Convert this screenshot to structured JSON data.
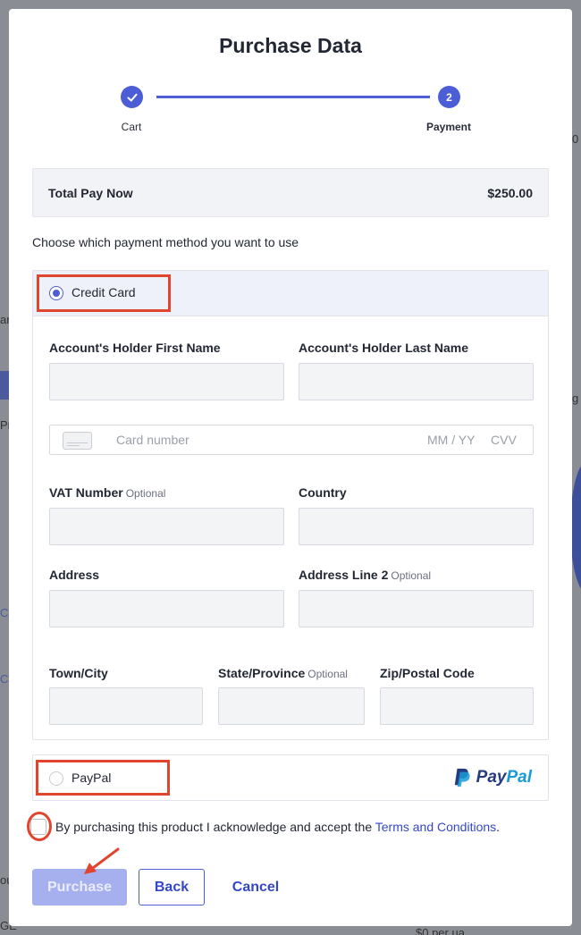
{
  "background": {
    "frag1": "0",
    "frag2": "g",
    "frag3": "an",
    "frag4": "Pr",
    "frag5": "Co",
    "frag6": "Ca",
    "frag7": "ou",
    "frag8": "GE",
    "frag9": "$0 per ua"
  },
  "modal": {
    "title": "Purchase Data",
    "steps": [
      {
        "label": "Cart",
        "state": "done",
        "icon": "check-icon"
      },
      {
        "label": "Payment",
        "number": "2",
        "state": "active"
      }
    ],
    "total": {
      "label": "Total Pay Now",
      "amount": "$250.00"
    },
    "choose_text": "Choose which payment method you want to use",
    "credit_card": {
      "label": "Credit Card",
      "selected": true,
      "first_name_label": "Account's Holder First Name",
      "last_name_label": "Account's Holder Last Name",
      "card_number_placeholder": "Card number",
      "expiry_placeholder": "MM / YY",
      "cvv_placeholder": "CVV",
      "vat_label": "VAT Number",
      "country_label": "Country",
      "address_label": "Address",
      "address2_label": "Address Line 2",
      "town_label": "Town/City",
      "state_label": "State/Province",
      "zip_label": "Zip/Postal Code",
      "optional_text": "Optional"
    },
    "paypal": {
      "label": "PayPal",
      "selected": false,
      "logo_part1": "Pay",
      "logo_part2": "Pal"
    },
    "terms": {
      "text": "By purchasing this product I acknowledge and accept the ",
      "link": "Terms and Conditions",
      "suffix": "."
    },
    "buttons": {
      "purchase": "Purchase",
      "back": "Back",
      "cancel": "Cancel"
    }
  },
  "colors": {
    "accent": "#4c5ed6",
    "annotation": "#e0452e",
    "paypal_dark": "#253b80",
    "paypal_light": "#179bd7"
  }
}
